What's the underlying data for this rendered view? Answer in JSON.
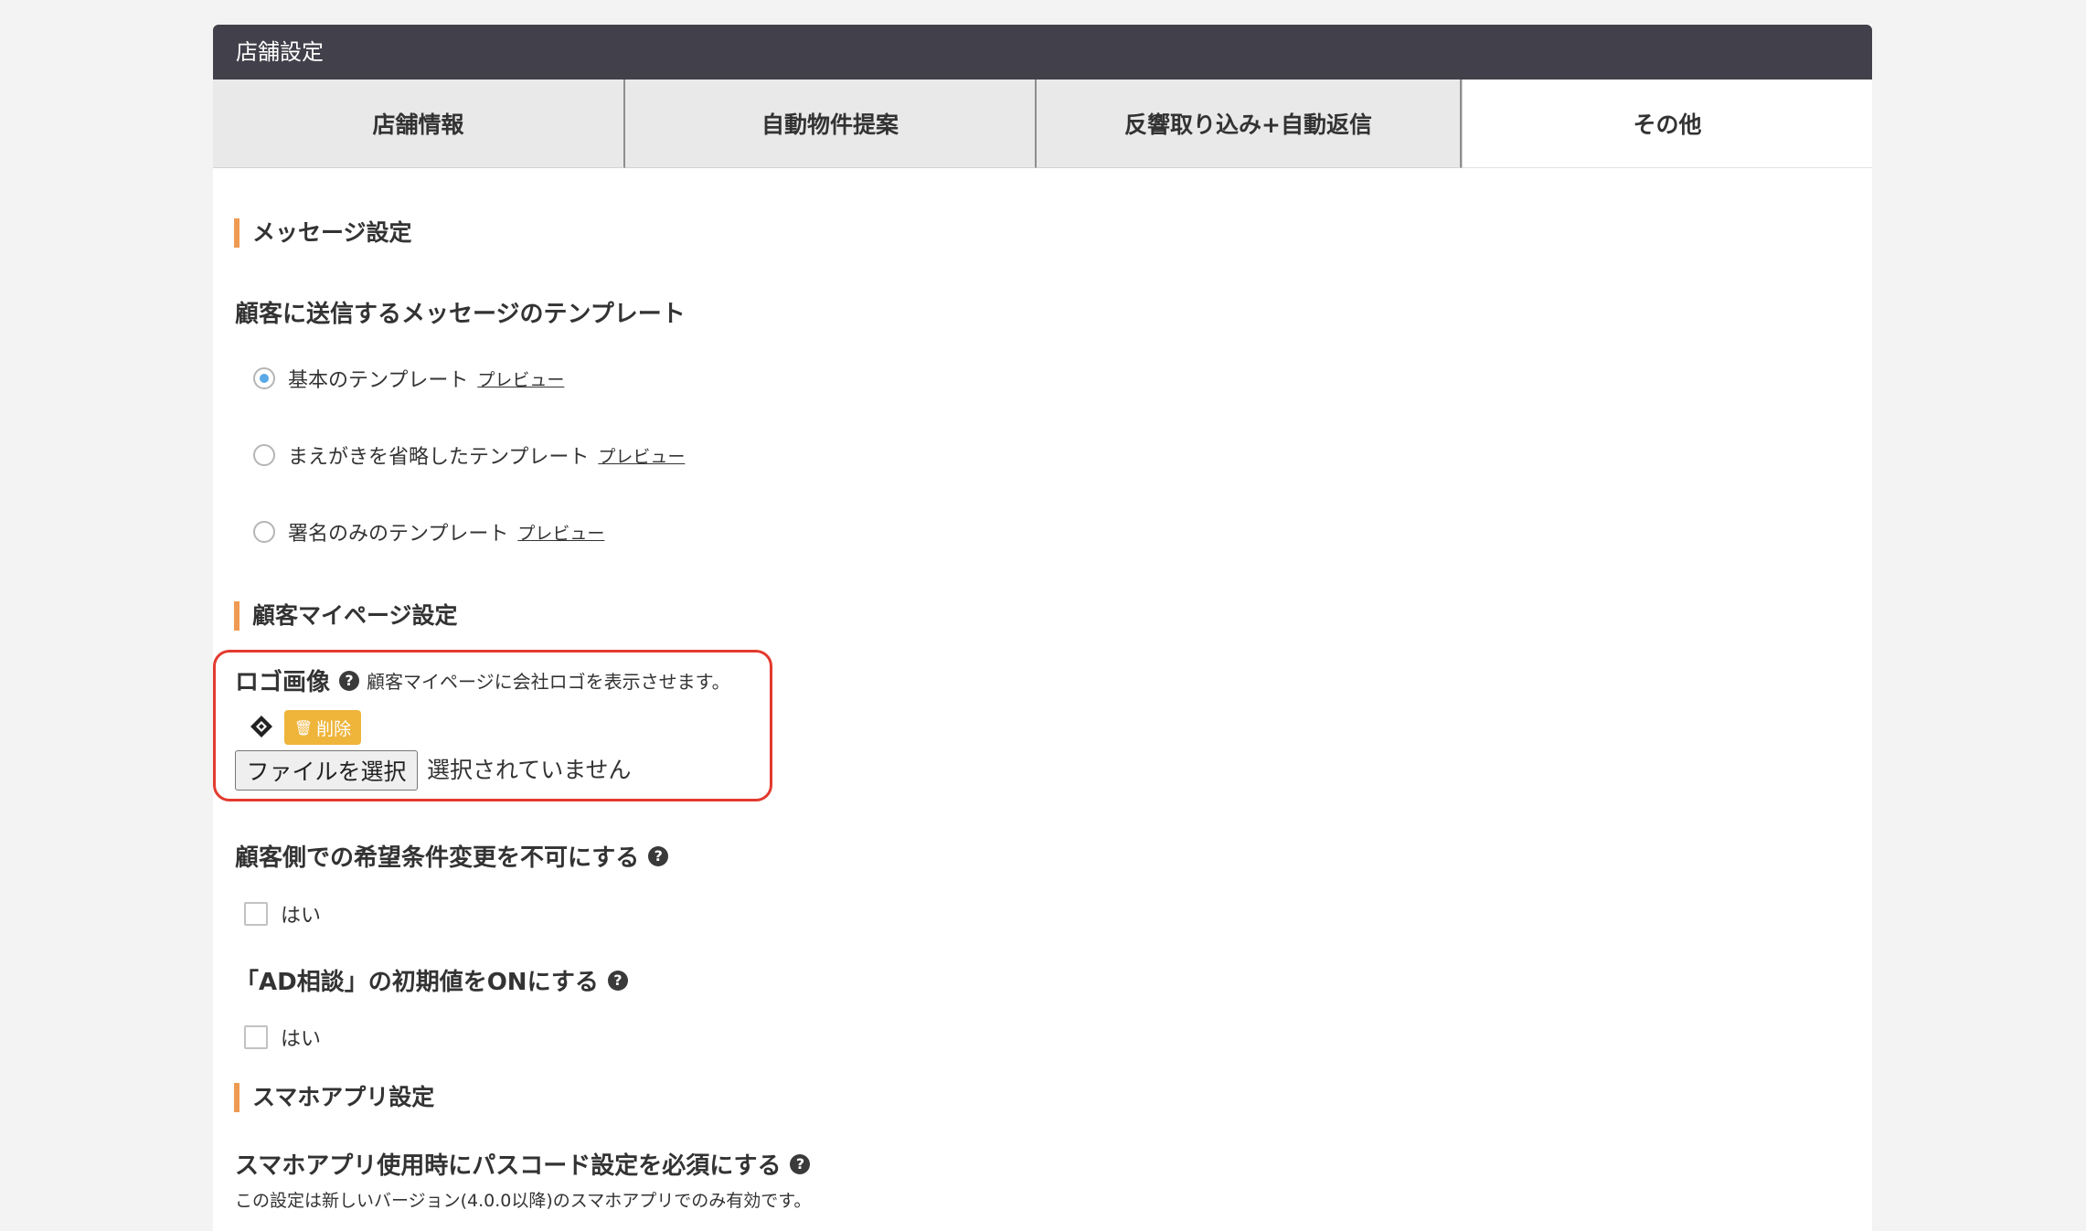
{
  "panel": {
    "title": "店舗設定"
  },
  "tabs": [
    {
      "label": "店舗情報"
    },
    {
      "label": "自動物件提案"
    },
    {
      "label": "反響取り込み+自動返信"
    },
    {
      "label": "その他",
      "active": true
    }
  ],
  "message_settings": {
    "section_title": "メッセージ設定",
    "template_heading": "顧客に送信するメッセージのテンプレート",
    "options": [
      {
        "label": "基本のテンプレート",
        "preview": "プレビュー",
        "selected": true
      },
      {
        "label": "まえがきを省略したテンプレート",
        "preview": "プレビュー",
        "selected": false
      },
      {
        "label": "署名のみのテンプレート",
        "preview": "プレビュー",
        "selected": false
      }
    ]
  },
  "mypage_settings": {
    "section_title": "顧客マイページ設定",
    "logo": {
      "label": "ロゴ画像",
      "help_icon": "question-circle-icon",
      "description": "顧客マイページに会社ロゴを表示させます。",
      "delete_label": "削除",
      "file_button": "ファイルを選択",
      "file_status": "選択されていません"
    },
    "disable_condition_change": {
      "label": "顧客側での希望条件変更を不可にする",
      "checkbox_label": "はい",
      "checked": false
    },
    "ad_consult_default": {
      "label": "「AD相談」の初期値をONにする",
      "checkbox_label": "はい",
      "checked": false
    }
  },
  "app_settings": {
    "section_title": "スマホアプリ設定",
    "passcode_required": {
      "label": "スマホアプリ使用時にパスコード設定を必須にする",
      "note": "この設定は新しいバージョン(4.0.0以降)のスマホアプリでのみ有効です。"
    }
  },
  "colors": {
    "header_bg": "#42404a",
    "section_accent": "#ee9a52",
    "delete_button": "#efb43a",
    "highlight_border": "#e33a2e",
    "radio_selected": "#5aa9e6"
  }
}
